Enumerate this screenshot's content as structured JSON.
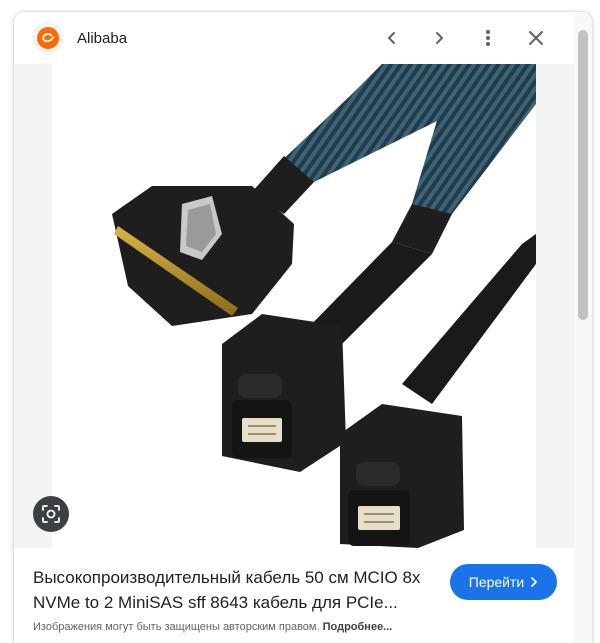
{
  "header": {
    "site_name": "Alibaba",
    "logo_icon": "alibaba-logo-icon",
    "buttons": [
      "chevron-left-icon",
      "chevron-right-icon",
      "more-vert-icon",
      "close-icon"
    ]
  },
  "colors": {
    "accent": "#1a73e8",
    "brand": "#ff6a00",
    "cable_sleeve": "#2f4a5a",
    "connector": "#1e1e1e"
  },
  "preview": {
    "lens_icon": "image-search-icon"
  },
  "result": {
    "title": "Высокопроизводительный кабель 50 см MCIO 8x NVMe to 2 MiniSAS sff 8643 кабель для PCIe...",
    "visit_label": "Перейти",
    "notice": "Изображения могут быть защищены авторским правом.",
    "more_label": "Подробнее..."
  }
}
